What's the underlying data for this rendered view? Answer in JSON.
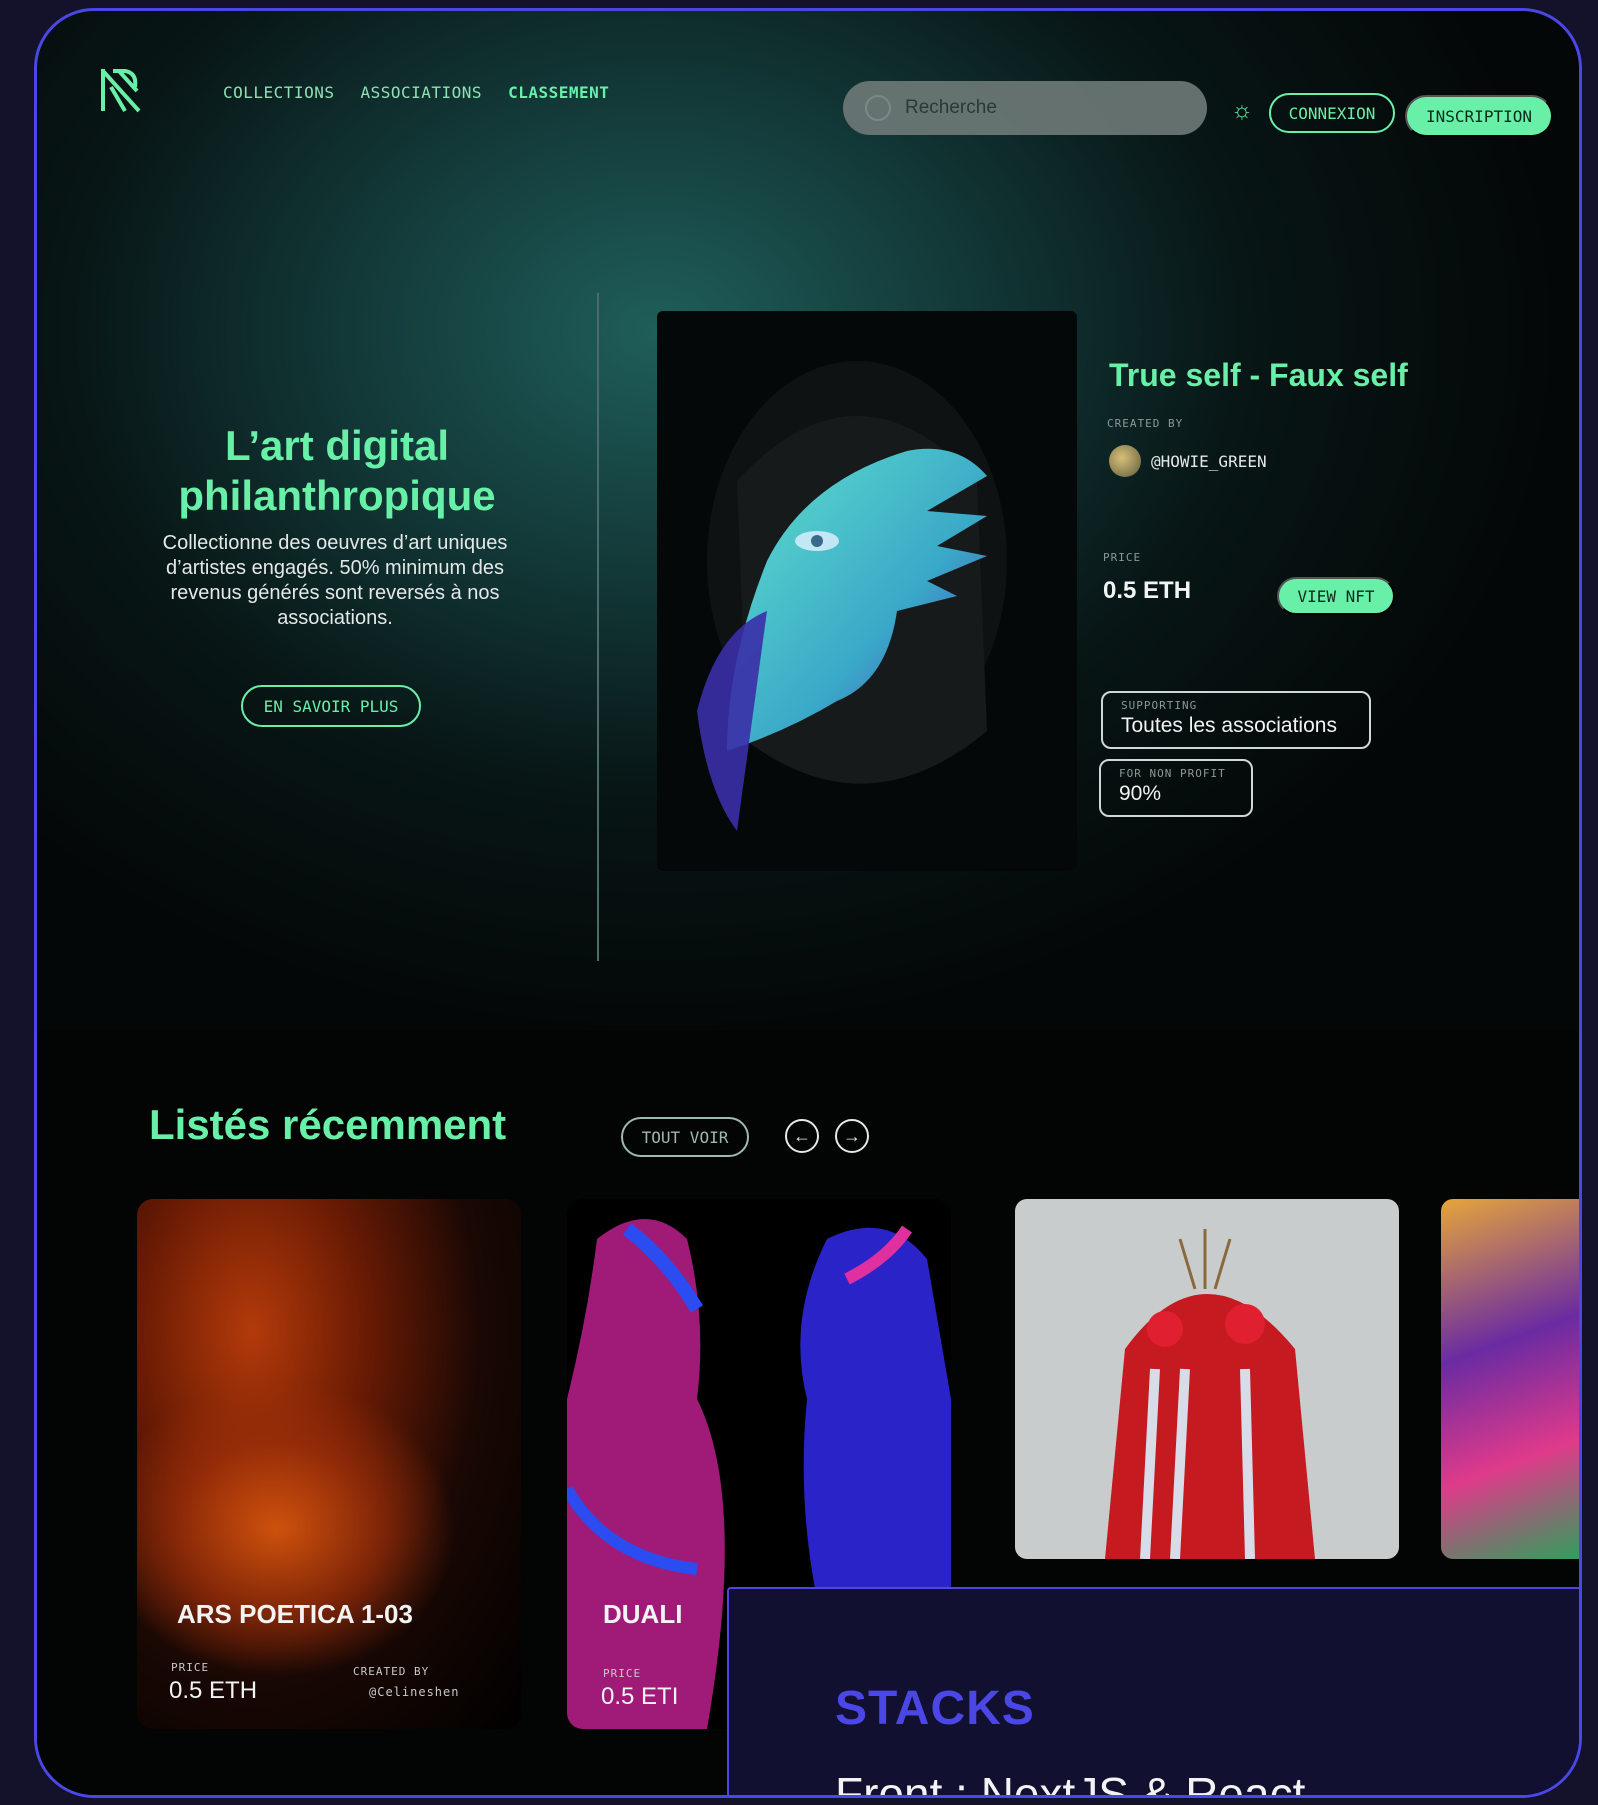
{
  "header": {
    "nav": [
      "COLLECTIONS",
      "ASSOCIATIONS",
      "CLASSEMENT"
    ],
    "search_placeholder": "Recherche",
    "login_label": "CONNEXION",
    "signup_label": "INSCRIPTION"
  },
  "hero": {
    "title_line1": "L’art digital",
    "title_line2": "philanthropique",
    "description": "Collectionne des oeuvres d’art uniques d’artistes engagés. 50% minimum des revenus générés sont reversés à nos associations.",
    "cta_label": "EN SAVOIR PLUS"
  },
  "featured": {
    "title": "True self - Faux self",
    "created_by_label": "CREATED BY",
    "creator": "@HOWIE_GREEN",
    "price_label": "PRICE",
    "price": "0.5 ETH",
    "view_label": "VIEW NFT",
    "supporting_label": "SUPPORTING",
    "supporting_value": "Toutes les associations",
    "nonprofit_label": "FOR NON PROFIT",
    "nonprofit_value": "90%"
  },
  "recent": {
    "title": "Listés récemment",
    "see_all_label": "TOUT VOIR",
    "cards": [
      {
        "name": "ARS POETICA 1-03",
        "price_label": "PRICE",
        "price": "0.5 ETH",
        "created_by_label": "CREATED BY",
        "creator": "@Celineshen"
      },
      {
        "name": "DUALI",
        "price_label": "PRICE",
        "price": "0.5 ETI"
      }
    ]
  },
  "stacks": {
    "title": "STACKS",
    "front": "Front : NextJS & React"
  },
  "colors": {
    "accent": "#69f0a8",
    "frame_border": "#4a47e6",
    "panel_bg": "#121030"
  }
}
